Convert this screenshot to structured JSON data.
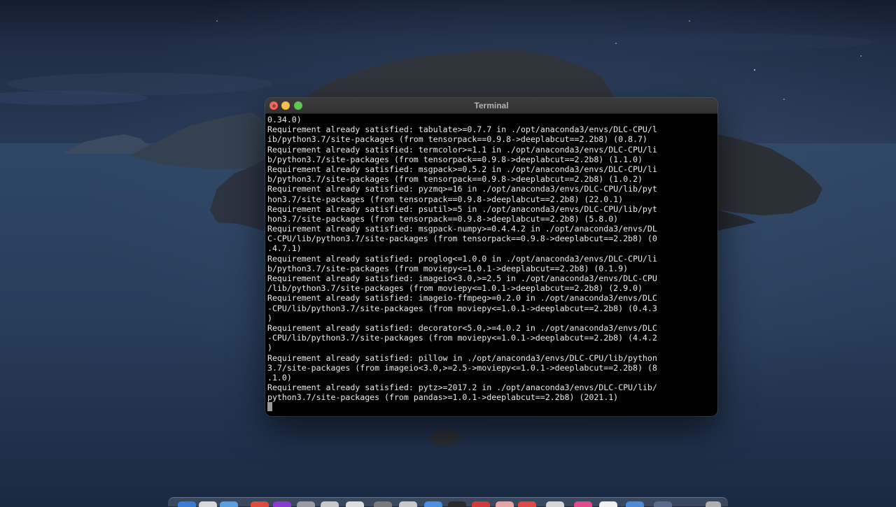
{
  "window": {
    "title": "Terminal"
  },
  "terminal": {
    "lines": [
      "0.34.0)",
      "Requirement already satisfied: tabulate>=0.7.7 in ./opt/anaconda3/envs/DLC-CPU/l",
      "ib/python3.7/site-packages (from tensorpack==0.9.8->deeplabcut==2.2b8) (0.8.7)",
      "Requirement already satisfied: termcolor>=1.1 in ./opt/anaconda3/envs/DLC-CPU/li",
      "b/python3.7/site-packages (from tensorpack==0.9.8->deeplabcut==2.2b8) (1.1.0)",
      "Requirement already satisfied: msgpack>=0.5.2 in ./opt/anaconda3/envs/DLC-CPU/li",
      "b/python3.7/site-packages (from tensorpack==0.9.8->deeplabcut==2.2b8) (1.0.2)",
      "Requirement already satisfied: pyzmq>=16 in ./opt/anaconda3/envs/DLC-CPU/lib/pyt",
      "hon3.7/site-packages (from tensorpack==0.9.8->deeplabcut==2.2b8) (22.0.1)",
      "Requirement already satisfied: psutil>=5 in ./opt/anaconda3/envs/DLC-CPU/lib/pyt",
      "hon3.7/site-packages (from tensorpack==0.9.8->deeplabcut==2.2b8) (5.8.0)",
      "Requirement already satisfied: msgpack-numpy>=0.4.4.2 in ./opt/anaconda3/envs/DL",
      "C-CPU/lib/python3.7/site-packages (from tensorpack==0.9.8->deeplabcut==2.2b8) (0",
      ".4.7.1)",
      "Requirement already satisfied: proglog<=1.0.0 in ./opt/anaconda3/envs/DLC-CPU/li",
      "b/python3.7/site-packages (from moviepy<=1.0.1->deeplabcut==2.2b8) (0.1.9)",
      "Requirement already satisfied: imageio<3.0,>=2.5 in ./opt/anaconda3/envs/DLC-CPU",
      "/lib/python3.7/site-packages (from moviepy<=1.0.1->deeplabcut==2.2b8) (2.9.0)",
      "Requirement already satisfied: imageio-ffmpeg>=0.2.0 in ./opt/anaconda3/envs/DLC",
      "-CPU/lib/python3.7/site-packages (from moviepy<=1.0.1->deeplabcut==2.2b8) (0.4.3",
      ")",
      "Requirement already satisfied: decorator<5.0,>=4.0.2 in ./opt/anaconda3/envs/DLC",
      "-CPU/lib/python3.7/site-packages (from moviepy<=1.0.1->deeplabcut==2.2b8) (4.4.2",
      ")",
      "Requirement already satisfied: pillow in ./opt/anaconda3/envs/DLC-CPU/lib/python",
      "3.7/site-packages (from imageio<3.0,>=2.5->moviepy<=1.0.1->deeplabcut==2.2b8) (8",
      ".1.0)",
      "Requirement already satisfied: pytz>=2017.2 in ./opt/anaconda3/envs/DLC-CPU/lib/",
      "python3.7/site-packages (from pandas>=1.0.1->deeplabcut==2.2b8) (2021.1)"
    ]
  },
  "icons": {
    "close": "close-button",
    "minimize": "minimize-button",
    "zoom": "zoom-button",
    "cursor": "block-cursor"
  },
  "colors": {
    "terminal_bg": "#000000",
    "terminal_text": "#eaeaea",
    "close": "#ed6a5e",
    "minimize": "#f5bf4f",
    "zoom": "#61c554",
    "desktop_sky": "#1c2a40",
    "desktop_sea": "#2c4261"
  }
}
